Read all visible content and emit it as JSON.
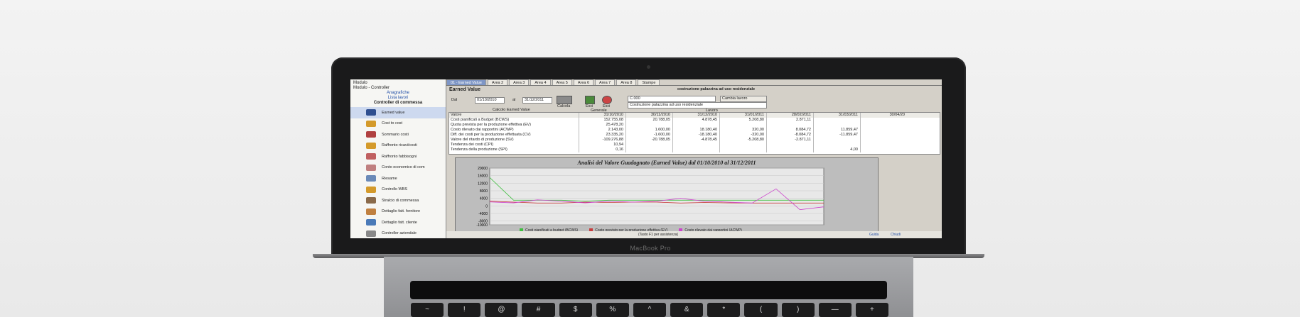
{
  "laptop": {
    "brand": "MacBook Pro",
    "keys": [
      "~",
      "!",
      "@",
      "#",
      "$",
      "%",
      "^",
      "&",
      "*",
      "(",
      ")",
      "—",
      "+"
    ]
  },
  "sidebar": {
    "module": "Modulo - Controller",
    "menu_top": "Modulo",
    "links": [
      "Anagrafiche",
      "Lista lavori"
    ],
    "section": "Controller di commessa",
    "items": [
      {
        "label": "Earned value",
        "active": true,
        "color": "#2f4f8f"
      },
      {
        "label": "Cost to cost",
        "color": "#d49a2a"
      },
      {
        "label": "Sommario costi",
        "color": "#b04040"
      },
      {
        "label": "Raffronto ricavi/costi",
        "color": "#d49a2a"
      },
      {
        "label": "Raffronto fabbisogni",
        "color": "#c06060"
      },
      {
        "label": "Conto economico di com",
        "color": "#c08080"
      },
      {
        "label": "Riesame",
        "color": "#6a8ab8"
      },
      {
        "label": "Controllo WBS",
        "color": "#d49a2a"
      },
      {
        "label": "Stralcio di commessa",
        "color": "#8a6a4a"
      },
      {
        "label": "Dettaglio fatt. fornitore",
        "color": "#c08040"
      },
      {
        "label": "Dettaglio fatt. cliente",
        "color": "#4a7ab8"
      },
      {
        "label": "Controller aziendale",
        "color": "#888888"
      }
    ]
  },
  "tabs": [
    "01 - Earned Value",
    "Area 2",
    "Area 3",
    "Area 4",
    "Area 5",
    "Area 6",
    "Area 7",
    "Area 8",
    "Stampe"
  ],
  "main": {
    "title": "Earned Value",
    "project_header": "costruzione palazzina ad uso residenziale",
    "dal_label": "Dal",
    "dal": "01/10/2010",
    "al_label": "al",
    "al": "31/12/2011",
    "calc_label": "Calcola",
    "calc_caption": "Calcolo Earned Value",
    "exit_label": "Esci",
    "exit2_label": "Esci",
    "generale": "Generale",
    "code": "C.000",
    "change_label": "Cambia lavoro",
    "project_desc": "Costruzione palazzina ad uso residenziale",
    "lavoro": "Lavoro"
  },
  "table": {
    "headers": [
      "Valore",
      "31/10/2010",
      "30/11/2010",
      "31/12/2010",
      "31/01/2011",
      "28/02/2011",
      "31/03/2011",
      "30/04/20"
    ],
    "rows": [
      [
        "Costi pianificati a Budget (BCWS)",
        "152.755,08",
        "20.788,05",
        "4.878,45",
        "5.208,80",
        "2.871,11",
        "",
        ""
      ],
      [
        "Quota prevista per la produzione effettiva (EV)",
        "25.478,20",
        "",
        "",
        "",
        "",
        "",
        ""
      ],
      [
        "Costo rilevato dai rapportini (ACWP)",
        "2.143,00",
        "1.600,00",
        "18.180,40",
        "320,00",
        "8.084,72",
        "11.859,47",
        ""
      ],
      [
        "Diff. dei costi per la produzione effettuata (CV)",
        "23.335,20",
        "-1.600,00",
        "-18.180,40",
        "-320,00",
        "-8.084,72",
        "-11.859,47",
        ""
      ],
      [
        "Valore del ritardo di produzione (SV)",
        "-109.276,88",
        "-20.788,05",
        "-4.878,45",
        "-5.208,80",
        "-2.871,11",
        "",
        ""
      ],
      [
        "Tendenza dei costi (CPI)",
        "10,94",
        "",
        "",
        "",
        "",
        "",
        ""
      ],
      [
        "Tendenza della produzione (SPI)",
        "0,16",
        "",
        "",
        "",
        "",
        "4,00",
        ""
      ]
    ]
  },
  "chart_data": {
    "type": "line",
    "title": "Analisi del Valore Guadagnato (Earned Value) dal 01/10/2010 al 31/12/2011",
    "ylim": [
      -10000,
      20000
    ],
    "yticks": [
      "20000",
      "16000",
      "12000",
      "8000",
      "4000",
      "0",
      "-4000",
      "-8000",
      "-10000"
    ],
    "x": [
      1,
      2,
      3,
      4,
      5,
      6,
      7,
      8,
      9,
      10,
      11,
      12,
      13,
      14,
      15
    ],
    "series": [
      {
        "name": "Costi pianificati a budget (BCWS)",
        "color": "#3fbf3f",
        "values": [
          15000,
          3000,
          3000,
          3000,
          2500,
          3000,
          3000,
          3000,
          3000,
          3000,
          3000,
          3000,
          3000,
          3000,
          3000
        ]
      },
      {
        "name": "Costo previsto per la produzione effettiva (EV)",
        "color": "#c83c3c",
        "values": [
          2500,
          2000,
          1500,
          1500,
          2000,
          1800,
          2000,
          2000,
          1500,
          1800,
          1600,
          1500,
          1500,
          1500,
          1500
        ]
      },
      {
        "name": "Costo rilevato dai rapportini (ACWP)",
        "color": "#cc44cc",
        "values": [
          2100,
          1600,
          3200,
          2500,
          1600,
          2500,
          2000,
          2500,
          4000,
          2500,
          2000,
          1500,
          9000,
          -2000,
          -500
        ]
      }
    ]
  },
  "status": {
    "left": "",
    "middle": "(Tasto F1 per assistenza)",
    "guide": "Guida",
    "chiudi": "Chiudi"
  }
}
